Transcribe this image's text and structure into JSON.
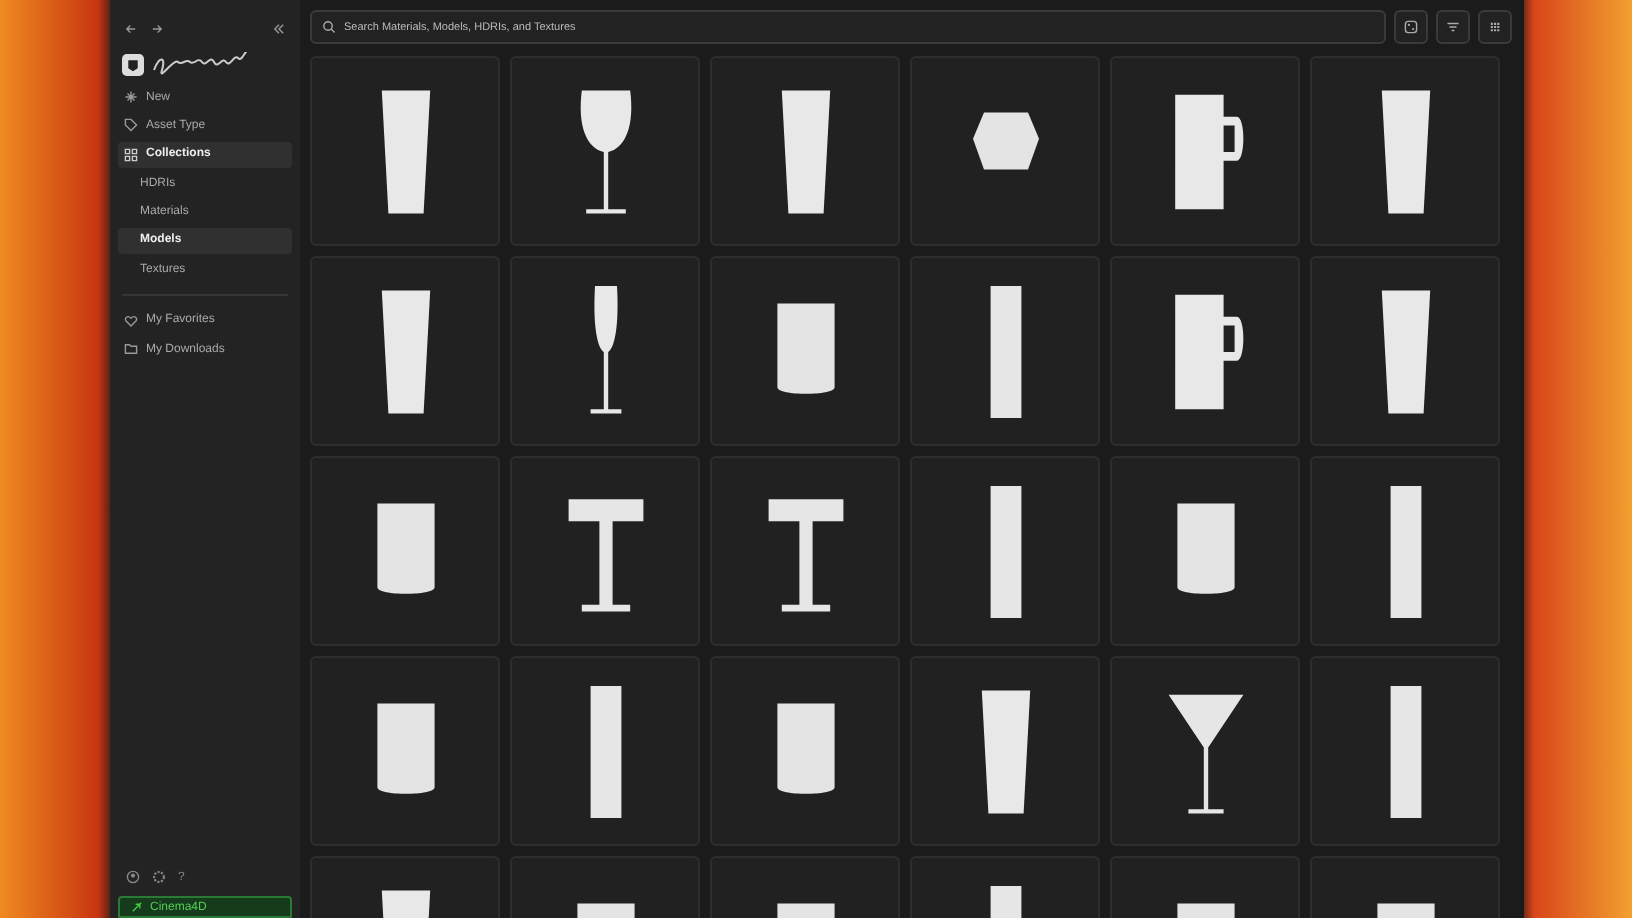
{
  "sidebar": {
    "items": [
      {
        "label": "New",
        "kind": "sparkle",
        "selected": false
      },
      {
        "label": "Asset Type",
        "kind": "tag",
        "selected": false
      },
      {
        "label": "Collections",
        "kind": "grid",
        "selected": true
      },
      {
        "label": "HDRIs",
        "kind": "sub",
        "selected": false
      },
      {
        "label": "Materials",
        "kind": "sub",
        "selected": false
      },
      {
        "label": "Models",
        "kind": "sub",
        "selected": true
      },
      {
        "label": "Textures",
        "kind": "sub",
        "selected": false
      }
    ],
    "library": [
      {
        "label": "My Favorites",
        "kind": "heart"
      },
      {
        "label": "My Downloads",
        "kind": "folder"
      }
    ],
    "help": "?",
    "app_button": "Cinema4D"
  },
  "search": {
    "placeholder": "Search Materials, Models, HDRIs, and Textures"
  },
  "models": [
    {
      "kind": "tumbler"
    },
    {
      "kind": "wine"
    },
    {
      "kind": "tumbler"
    },
    {
      "kind": "bowl"
    },
    {
      "kind": "mug"
    },
    {
      "kind": "tumbler"
    },
    {
      "kind": "tumbler"
    },
    {
      "kind": "flute"
    },
    {
      "kind": "cup"
    },
    {
      "kind": "tall"
    },
    {
      "kind": "mug"
    },
    {
      "kind": "tumbler"
    },
    {
      "kind": "cup"
    },
    {
      "kind": "coupe"
    },
    {
      "kind": "coupe"
    },
    {
      "kind": "tall"
    },
    {
      "kind": "cup"
    },
    {
      "kind": "tall"
    },
    {
      "kind": "cup"
    },
    {
      "kind": "tall"
    },
    {
      "kind": "cup"
    },
    {
      "kind": "tumbler"
    },
    {
      "kind": "martini"
    },
    {
      "kind": "tall"
    },
    {
      "kind": "tumbler"
    },
    {
      "kind": "cup"
    },
    {
      "kind": "cup"
    },
    {
      "kind": "tall"
    },
    {
      "kind": "cup"
    },
    {
      "kind": "cup"
    }
  ]
}
